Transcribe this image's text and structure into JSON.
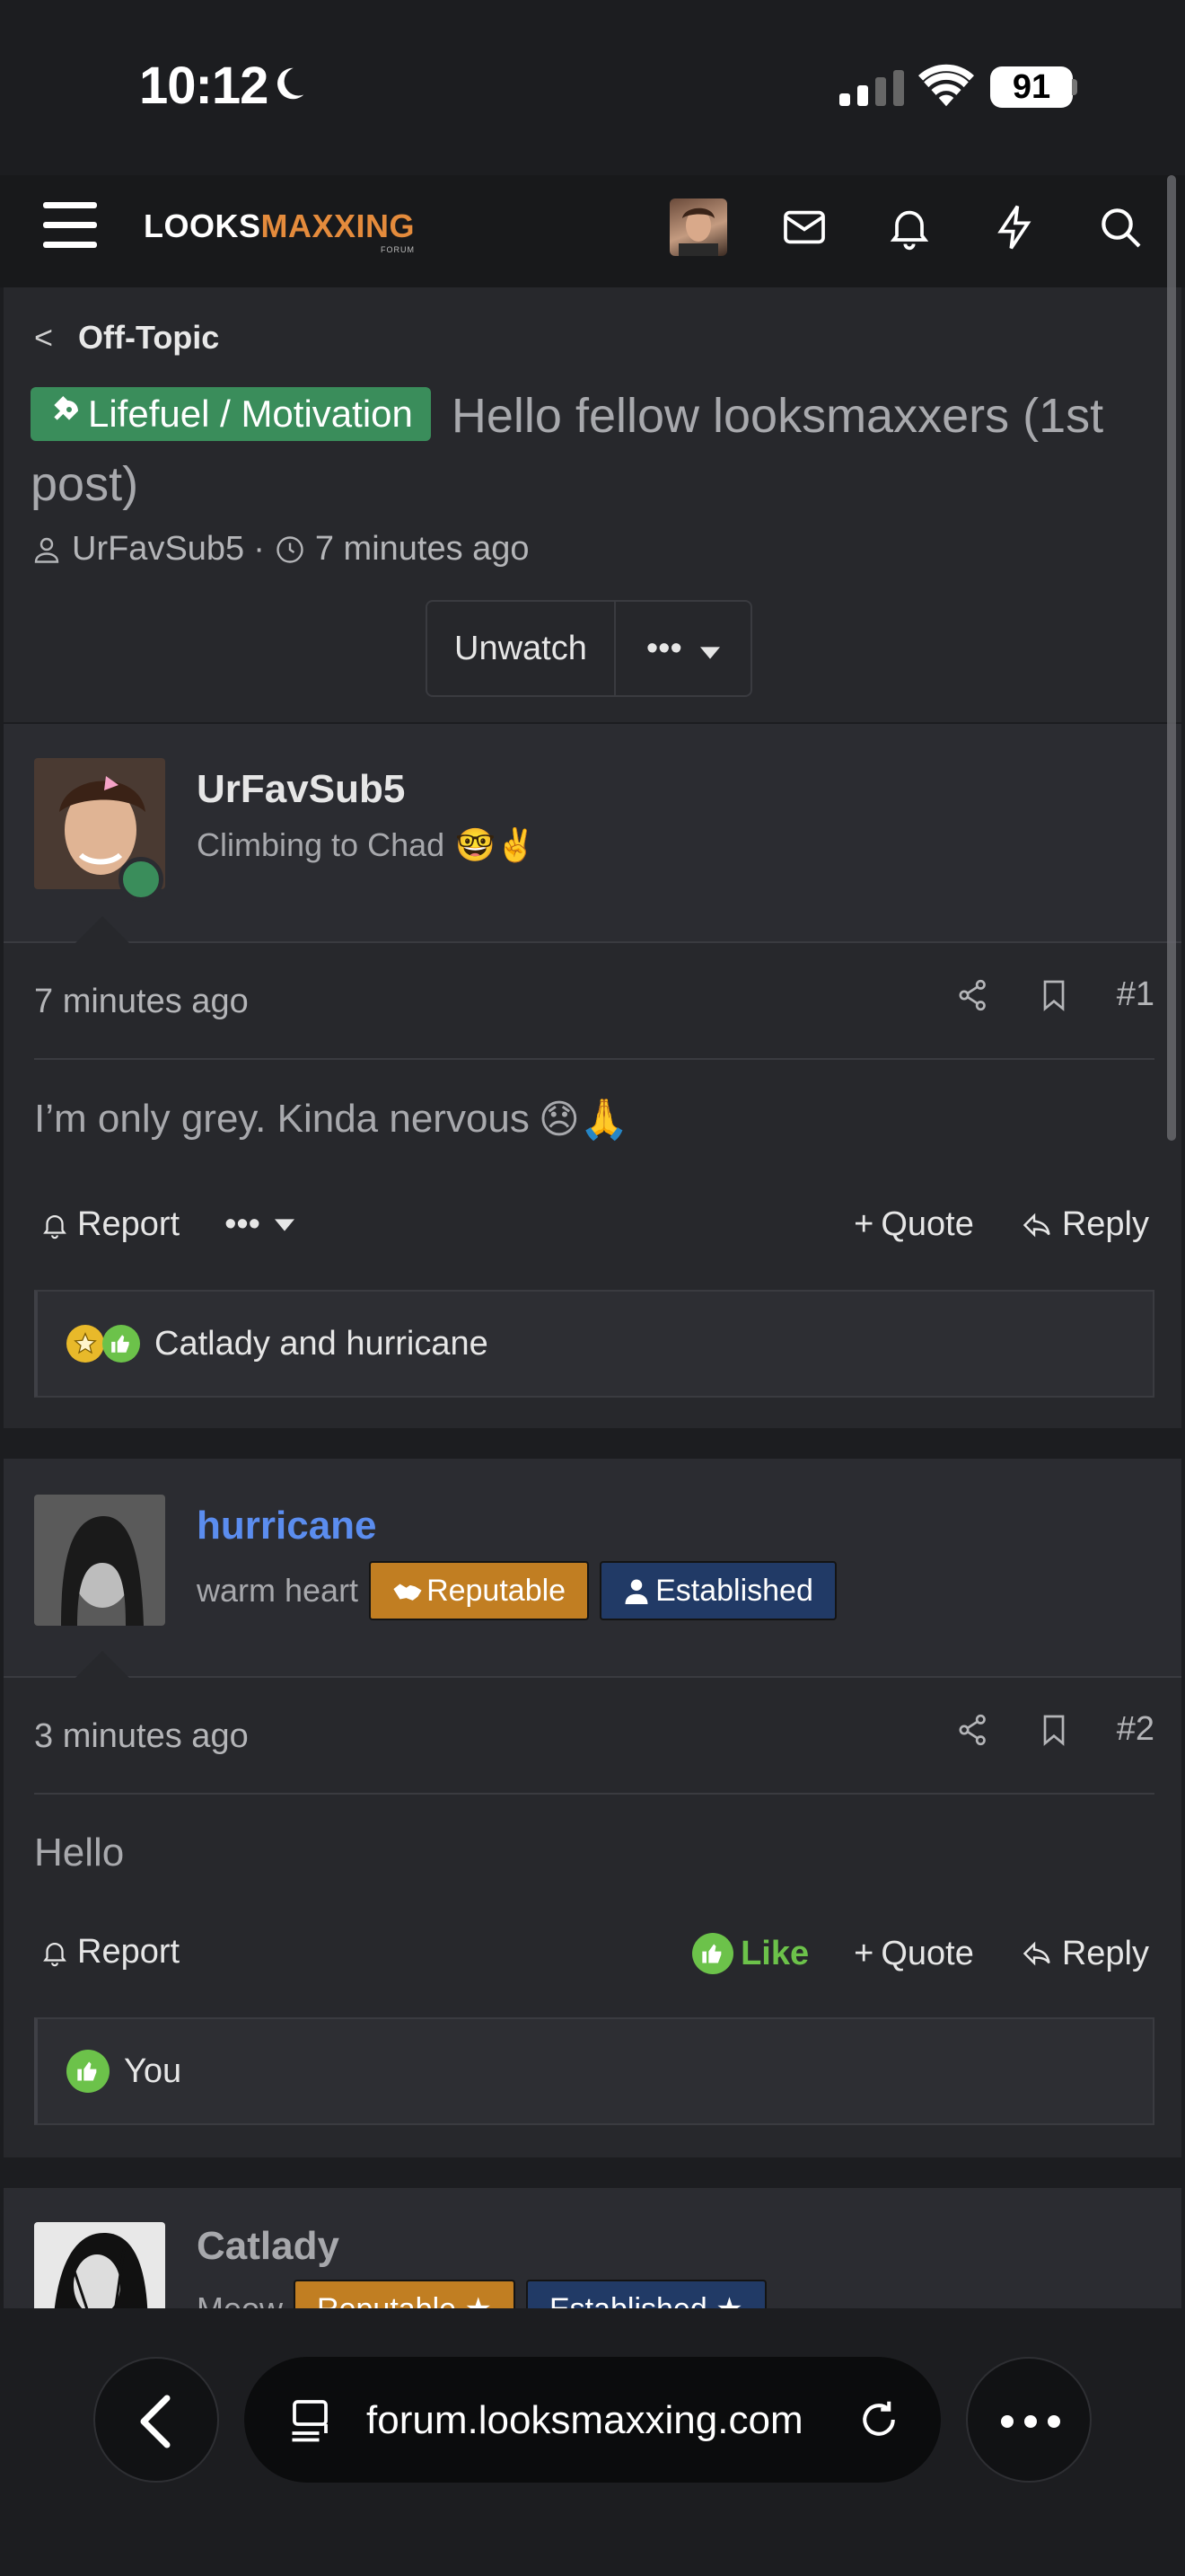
{
  "status_bar": {
    "time": "10:12",
    "battery": "91"
  },
  "site": {
    "logo_a": "LOOKS",
    "logo_b": "MAXXING",
    "logo_sub": "FORUM"
  },
  "breadcrumb": {
    "label": "Off-Topic"
  },
  "thread": {
    "prefix": "Lifefuel / Motivation",
    "title": "Hello fellow looksmaxxers (1st post)",
    "author": "UrFavSub5",
    "separator": "·",
    "age": "7 minutes ago",
    "unwatch_label": "Unwatch",
    "more_label": "•••"
  },
  "posts": [
    {
      "username": "UrFavSub5",
      "user_title": "Climbing to Chad",
      "title_emoji": "🤓✌️",
      "time": "7 minutes ago",
      "number": "#1",
      "text": "I’m only grey. Kinda nervous",
      "text_emoji": "😞🙏",
      "report_label": "Report",
      "more_label": "•••",
      "quote_label": "Quote",
      "reply_label": "Reply",
      "reactions": "Catlady and hurricane"
    },
    {
      "username": "hurricane",
      "user_title": "warm heart",
      "badge_rep": "Reputable",
      "badge_est": "Established",
      "time": "3 minutes ago",
      "number": "#2",
      "text": "Hello",
      "report_label": "Report",
      "like_label": "Like",
      "quote_label": "Quote",
      "reply_label": "Reply",
      "reactions": "You"
    },
    {
      "username": "Catlady",
      "user_title": "Meow",
      "badge_rep": "Reputable ★",
      "badge_est": "Established ★"
    }
  ],
  "browser": {
    "url": "forum.looksmaxxing.com"
  },
  "colors": {
    "prefix_green": "#3a8d5b",
    "username_blue": "#5b8def",
    "reputable_gold": "#c17e22",
    "established_navy": "#213a66",
    "like_green": "#6cc24a"
  }
}
